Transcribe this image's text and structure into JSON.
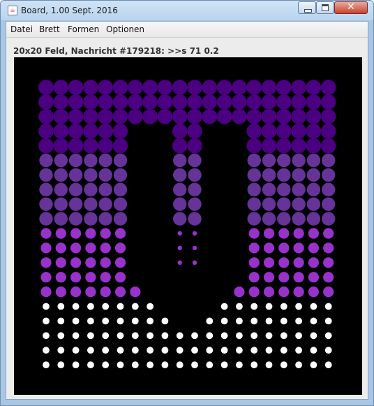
{
  "window": {
    "title": "Board, 1.00 Sept. 2016",
    "close_glyph": "✕",
    "app_icon": "java-icon"
  },
  "menu": [
    "Datei",
    "Brett",
    "Formen",
    "Optionen"
  ],
  "status": "20x20 Feld, Nachricht #179218: >>s 71 0.2",
  "board": {
    "cols": 20,
    "rows": 20,
    "background": "#000000",
    "palette": {
      "D": "#4b0082",
      "M": "#663399",
      "P": "#9932cc",
      "W": "#ffffff"
    },
    "size_levels": {
      "L": 1.0,
      "M": 0.9,
      "S": 0.7,
      "T": 0.45,
      "X": 0.3
    },
    "cells": [
      "DL DL DL DL DL DL DL DL DL DL DL DL DL DL DL DL DL DL DL DL",
      "DL DL DL DL DL DL DL DL DL DL DL DL DL DL DL DL DL DL DL DL",
      "DL DL DL DL DL DL DL DL DL DL DL DL DL DL DL DL DL DL DL DL",
      "DL DL DL DL DL DL -- -- -- DL DL -- -- -- DL DL DL DL DL DL",
      "DL DL DL DL DL DL -- -- -- DL DL -- -- -- DL DL DL DL DL DL",
      "MM MM MM MM MM MM -- -- -- MM MM -- -- -- MM MM MM MM MM MM",
      "MM MM MM MM MM MM -- -- -- MM MM -- -- -- MM MM MM MM MM MM",
      "MM MM MM MM MM MM -- -- -- MM MM -- -- -- MM MM MM MM MM MM",
      "MM MM MM MM MM MM -- -- -- MM MM -- -- -- MM MM MM MM MM MM",
      "MM MM MM MM MM MM -- -- -- MM MM -- -- -- MM MM MM MM MM MM",
      "PS PS PS PS PS PS -- -- -- PX PX -- -- -- PS PS PS PS PS PS",
      "PS PS PS PS PS PS -- -- -- PX PX -- -- -- PS PS PS PS PS PS",
      "PS PS PS PS PS PS -- -- -- PX PX -- -- -- PS PS PS PS PS PS",
      "PS PS PS PS PS PS -- -- -- -- -- -- -- -- PS PS PS PS PS PS",
      "PS PS PS PS PS PS PS -- -- -- -- -- -- PS PS PS PS PS PS PS",
      "WT WT WT WT WT WT WT WT -- -- -- -- WT WT WT WT WT WT WT WT",
      "WT WT WT WT WT WT WT WT WT -- -- WT WT WT WT WT WT WT WT WT",
      "WT WT WT WT WT WT WT WT WT WT WT WT WT WT WT WT WT WT WT WT",
      "WT WT WT WT WT WT WT WT WT WT WT WT WT WT WT WT WT WT WT WT",
      "WT WT WT WT WT WT WT WT WT WT WT WT WT WT WT WT WT WT WT WT"
    ]
  }
}
